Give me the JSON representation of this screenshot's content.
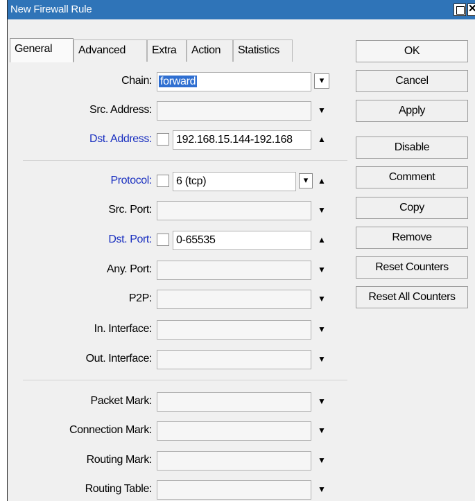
{
  "window": {
    "title": "New Firewall Rule"
  },
  "tabs": [
    {
      "label": "General",
      "active": true
    },
    {
      "label": "Advanced",
      "active": false
    },
    {
      "label": "Extra",
      "active": false
    },
    {
      "label": "Action",
      "active": false
    },
    {
      "label": "Statistics",
      "active": false
    }
  ],
  "fields": {
    "chain": {
      "label": "Chain:",
      "value": "forward"
    },
    "src_address": {
      "label": "Src. Address:",
      "value": ""
    },
    "dst_address": {
      "label": "Dst. Address:",
      "value": "192.168.15.144-192.168"
    },
    "protocol": {
      "label": "Protocol:",
      "value": "6 (tcp)"
    },
    "src_port": {
      "label": "Src. Port:",
      "value": ""
    },
    "dst_port": {
      "label": "Dst. Port:",
      "value": "0-65535"
    },
    "any_port": {
      "label": "Any. Port:",
      "value": ""
    },
    "p2p": {
      "label": "P2P:",
      "value": ""
    },
    "in_interface": {
      "label": "In. Interface:",
      "value": ""
    },
    "out_interface": {
      "label": "Out. Interface:",
      "value": ""
    },
    "packet_mark": {
      "label": "Packet Mark:",
      "value": ""
    },
    "connection_mark": {
      "label": "Connection Mark:",
      "value": ""
    },
    "routing_mark": {
      "label": "Routing Mark:",
      "value": ""
    },
    "routing_table": {
      "label": "Routing Table:",
      "value": ""
    }
  },
  "buttons": {
    "ok": "OK",
    "cancel": "Cancel",
    "apply": "Apply",
    "disable": "Disable",
    "comment": "Comment",
    "copy": "Copy",
    "remove": "Remove",
    "reset_counters": "Reset Counters",
    "reset_all_counters": "Reset All Counters"
  },
  "icons": {
    "dropdown": "dropdown-arrow-icon",
    "collapse": "triangle-up-icon",
    "expand": "triangle-down-icon"
  },
  "colors": {
    "titlebar": "#2f74b8",
    "label_blue": "#1a30c0",
    "selection": "#2f6fd1"
  }
}
